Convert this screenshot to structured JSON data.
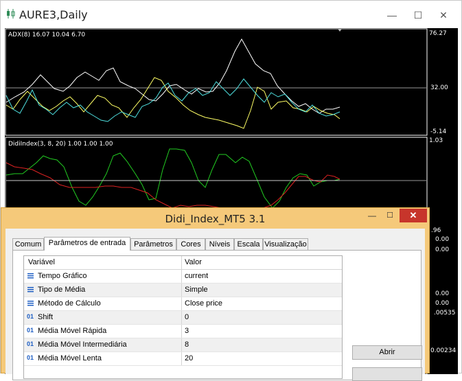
{
  "chart_window": {
    "title": "AURE3,Daily",
    "indicator_top_label": "ADX(8) 16.07 10.04 6.70",
    "indicator_bottom_label": "DidiIndex(3, 8, 20) 1.00 1.00 1.00",
    "top_axis": [
      "76.27",
      "32.00",
      "-5.14"
    ],
    "bottom_axis": [
      "1.03",
      ".96",
      "0.00",
      "0.00",
      "0.00",
      "0.00",
      ".00535",
      "0.00234"
    ],
    "colors": {
      "background": "#000000",
      "adx_main": "#ffffff",
      "adx_plus": "#ffff66",
      "adx_minus": "#4fe0e0",
      "didi_fast": "#22cc22",
      "didi_slow": "#dd2222",
      "didi_mid": "#cccccc"
    }
  },
  "dialog": {
    "title": "Didi_Index_MT5 3.1",
    "tabs": [
      "Comum",
      "Parâmetros de entrada",
      "Parâmetros",
      "Cores",
      "Níveis",
      "Escala",
      "Visualização"
    ],
    "active_tab": "Parâmetros de entrada",
    "table": {
      "headers": {
        "name": "Variável",
        "value": "Valor"
      },
      "rows": [
        {
          "icon": "enum-icon",
          "name": "Tempo Gráfico",
          "value": "current"
        },
        {
          "icon": "enum-icon",
          "name": "Tipo de Média",
          "value": "Simple"
        },
        {
          "icon": "enum-icon",
          "name": "Método de Cálculo",
          "value": "Close price"
        },
        {
          "icon": "int-icon",
          "name": "Shift",
          "value": "0"
        },
        {
          "icon": "int-icon",
          "name": "Média Móvel Rápida",
          "value": "3"
        },
        {
          "icon": "int-icon",
          "name": "Média Móvel Intermediária",
          "value": "8"
        },
        {
          "icon": "int-icon",
          "name": "Média Móvel Lenta",
          "value": "20"
        }
      ]
    },
    "buttons": {
      "open": "Abrir"
    },
    "window_buttons": {
      "minimize": "—",
      "maximize": "☐",
      "close": "✕"
    }
  },
  "chart_window_buttons": {
    "minimize": "—",
    "maximize": "☐",
    "close": "✕"
  },
  "icon_glyphs": {
    "enum": "≡",
    "int": "01"
  }
}
